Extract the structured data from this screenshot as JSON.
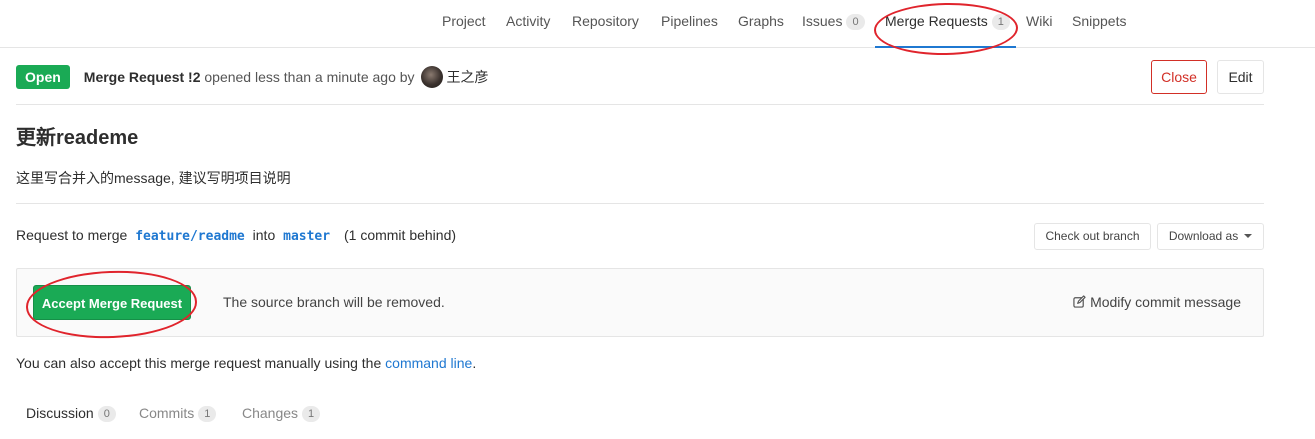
{
  "nav": {
    "tabs": [
      {
        "label": "Project"
      },
      {
        "label": "Activity"
      },
      {
        "label": "Repository"
      },
      {
        "label": "Pipelines"
      },
      {
        "label": "Graphs"
      },
      {
        "label": "Issues",
        "count": "0"
      },
      {
        "label": "Merge Requests",
        "count": "1",
        "active": true
      },
      {
        "label": "Wiki"
      },
      {
        "label": "Snippets"
      }
    ]
  },
  "mr": {
    "status": "Open",
    "ref": "Merge Request !2",
    "opened_text": "opened less than a minute ago by",
    "author": "王之彦",
    "close_label": "Close",
    "edit_label": "Edit",
    "title": "更新reademe",
    "description": "这里写合并入的message, 建议写明项目说明"
  },
  "merge": {
    "prefix": "Request to merge",
    "source_branch": "feature/readme",
    "into": "into",
    "target_branch": "master",
    "behind": "(1 commit behind)",
    "checkout_label": "Check out branch",
    "download_label": "Download as",
    "accept_label": "Accept Merge Request",
    "note": "The source branch will be removed.",
    "modify_label": "Modify commit message",
    "manual_prefix": "You can also accept this merge request manually using the",
    "manual_link": "command line",
    "manual_suffix": "."
  },
  "subtabs": [
    {
      "label": "Discussion",
      "count": "0",
      "active": true
    },
    {
      "label": "Commits",
      "count": "1"
    },
    {
      "label": "Changes",
      "count": "1"
    }
  ],
  "colors": {
    "accent": "#1f78d1",
    "open_badge": "#1aaa55",
    "accept_button": "#1aaa55",
    "close_button": "#d22f26",
    "annotation": "#e0242c"
  },
  "icons": {
    "modify": "pencil-square-icon",
    "download_caret": "caret-down-icon"
  }
}
